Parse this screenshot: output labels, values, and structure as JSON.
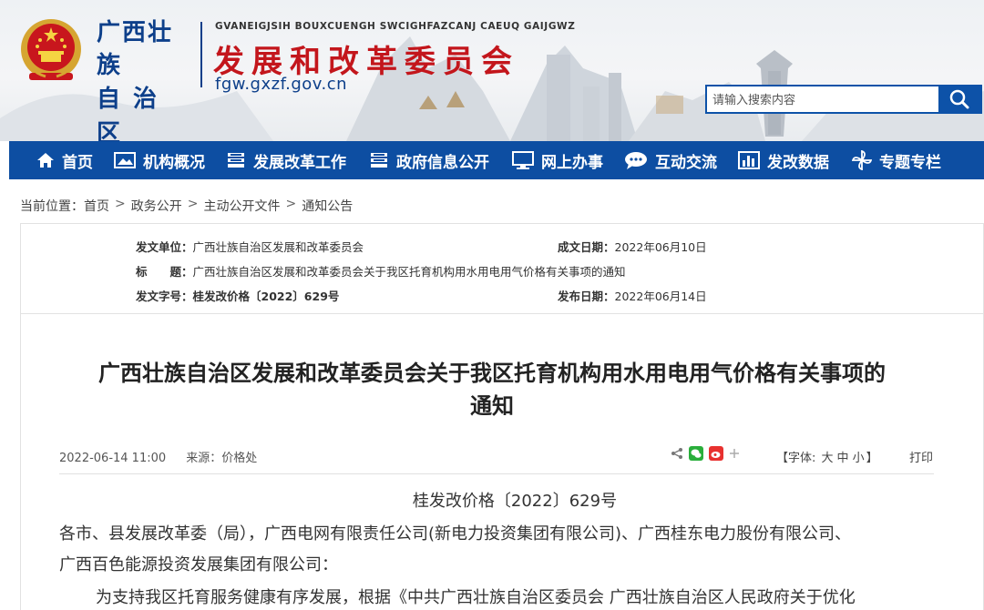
{
  "header": {
    "region_line1": "广西壮族",
    "region_line2": "自治区",
    "zhuang_subtitle": "GVANEIGJSIH BOUXCUENGH SWCIGHFAZCANJ CAEUQ GAIJGWZ",
    "agency": "发展和改革委员会",
    "domain": "fgw.gxzf.gov.cn",
    "search_placeholder": "请输入搜索内容",
    "emblem_icon": "national-emblem-icon"
  },
  "nav": [
    {
      "label": "首页",
      "icon": "home-icon"
    },
    {
      "label": "机构概况",
      "icon": "picture-icon"
    },
    {
      "label": "发展改革工作",
      "icon": "stack-icon"
    },
    {
      "label": "政府信息公开",
      "icon": "stack-icon"
    },
    {
      "label": "网上办事",
      "icon": "monitor-icon"
    },
    {
      "label": "互动交流",
      "icon": "chat-icon"
    },
    {
      "label": "发改数据",
      "icon": "bar-chart-icon"
    },
    {
      "label": "专题专栏",
      "icon": "pinwheel-icon"
    }
  ],
  "breadcrumb": {
    "prefix": "当前位置：",
    "items": [
      "首页",
      "政务公开",
      "主动公开文件",
      "通知公告"
    ],
    "separator": ">"
  },
  "meta": {
    "issuer_label": "发文单位：",
    "issuer": "广西壮族自治区发展和改革委员会",
    "date_created_label": "成文日期：",
    "date_created": "2022年06月10日",
    "title_label": "标　　题：",
    "title": "广西壮族自治区发展和改革委员会关于我区托育机构用水用电用气价格有关事项的通知",
    "doc_no_label": "发文字号：",
    "doc_no": "桂发改价格〔2022〕629号",
    "date_published_label": "发布日期：",
    "date_published": "2022年06月14日"
  },
  "article": {
    "title_line1": "广西壮族自治区发展和改革委员会关于我区托育机构用水用电用气价格有关事项的",
    "title_line2": "通知",
    "datetime": "2022-06-14 11:00",
    "source": "来源：价格处",
    "font_label_open": "【字体:",
    "font_large": "大",
    "font_medium": "中",
    "font_small": "小",
    "font_label_close": "】",
    "print": "打印",
    "doc_no": "桂发改价格〔2022〕629号",
    "para1_line1": "各市、县发展改革委（局），广西电网有限责任公司(新电力投资集团有限公司)、广西桂东电力股份有限公司、",
    "para1_line2": "广西百色能源投资发展集团有限公司：",
    "para2_line1": "　为支持我区托育服务健康有序发展，根据《中共广西壮族自治区委员会 广西壮族自治区人民政府关于优化"
  },
  "colors": {
    "nav_blue": "#0d4ea2",
    "title_red": "#c3161c",
    "brand_blue": "#0d3f8a"
  }
}
